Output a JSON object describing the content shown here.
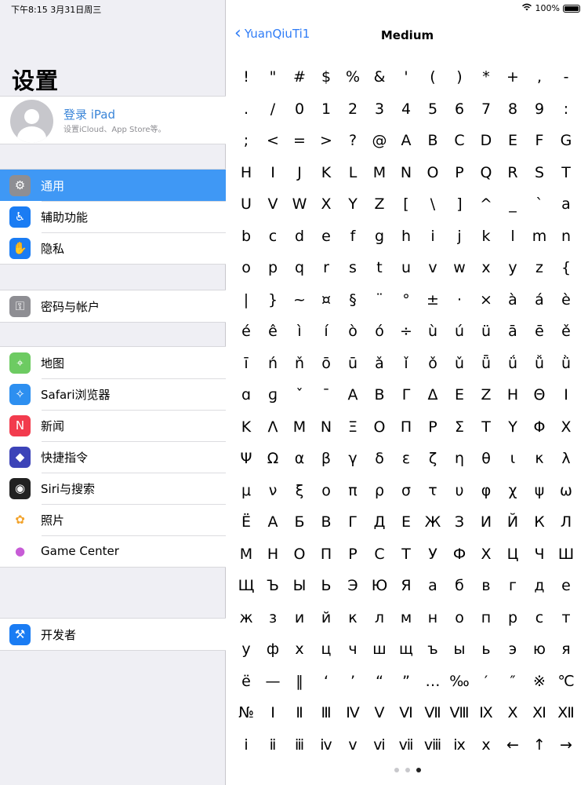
{
  "status": {
    "time": "下午8:15   3月31日周三",
    "wifi": "wifi-icon",
    "battery": "100%"
  },
  "sidebar": {
    "title": "设置",
    "profile": {
      "name": "登录 iPad",
      "subtitle": "设置iCloud、App Store等。"
    },
    "groups": [
      {
        "items": [
          {
            "label": "通用",
            "icon": "gear-icon",
            "color": "#8e8e93",
            "selected": true
          },
          {
            "label": "辅助功能",
            "icon": "accessibility-icon",
            "color": "#1a7cf3"
          },
          {
            "label": "隐私",
            "icon": "hand-icon",
            "color": "#1a7cf3"
          }
        ]
      },
      {
        "items": [
          {
            "label": "密码与帐户",
            "icon": "key-icon",
            "color": "#8e8e93"
          }
        ]
      },
      {
        "items": [
          {
            "label": "地图",
            "icon": "maps-icon",
            "color": "#6dcb62"
          },
          {
            "label": "Safari浏览器",
            "icon": "safari-icon",
            "color": "#2d8ff0"
          },
          {
            "label": "新闻",
            "icon": "news-icon",
            "color": "#f23b4d"
          },
          {
            "label": "快捷指令",
            "icon": "shortcuts-icon",
            "color": "#3c43b8"
          },
          {
            "label": "Siri与搜索",
            "icon": "siri-icon",
            "color": "#222222"
          },
          {
            "label": "照片",
            "icon": "photos-icon",
            "color": "#ffffff"
          },
          {
            "label": "Game Center",
            "icon": "game-center-icon",
            "color": "#ffffff"
          }
        ]
      },
      {
        "items": [
          {
            "label": "开发者",
            "icon": "hammer-icon",
            "color": "#1a7cf3"
          }
        ]
      }
    ]
  },
  "detail": {
    "back_label": "YuanQiuTi1",
    "title": "Medium",
    "glyph_rows": [
      [
        "!",
        "\"",
        "#",
        "$",
        "%",
        "&",
        "'",
        "(",
        ")",
        "*",
        "+",
        ",",
        "-"
      ],
      [
        ".",
        "/",
        "0",
        "1",
        "2",
        "3",
        "4",
        "5",
        "6",
        "7",
        "8",
        "9",
        ":"
      ],
      [
        ";",
        "<",
        "=",
        ">",
        "?",
        "@",
        "A",
        "B",
        "C",
        "D",
        "E",
        "F",
        "G"
      ],
      [
        "H",
        "I",
        "J",
        "K",
        "L",
        "M",
        "N",
        "O",
        "P",
        "Q",
        "R",
        "S",
        "T"
      ],
      [
        "U",
        "V",
        "W",
        "X",
        "Y",
        "Z",
        "[",
        "\\",
        "]",
        "^",
        "_",
        "`",
        "a"
      ],
      [
        "b",
        "c",
        "d",
        "e",
        "f",
        "g",
        "h",
        "i",
        "j",
        "k",
        "l",
        "m",
        "n"
      ],
      [
        "o",
        "p",
        "q",
        "r",
        "s",
        "t",
        "u",
        "v",
        "w",
        "x",
        "y",
        "z",
        "{"
      ],
      [
        "|",
        "}",
        "~",
        "¤",
        "§",
        "¨",
        "°",
        "±",
        "·",
        "×",
        "à",
        "á",
        "è"
      ],
      [
        "é",
        "ê",
        "ì",
        "í",
        "ò",
        "ó",
        "÷",
        "ù",
        "ú",
        "ü",
        "ā",
        "ē",
        "ě"
      ],
      [
        "ī",
        "ń",
        "ň",
        "ō",
        "ū",
        "ǎ",
        "ǐ",
        "ǒ",
        "ǔ",
        "ǖ",
        "ǘ",
        "ǚ",
        "ǜ"
      ],
      [
        "ɑ",
        "ɡ",
        "ˇ",
        "ˉ",
        "Α",
        "Β",
        "Γ",
        "Δ",
        "Ε",
        "Ζ",
        "Η",
        "Θ",
        "Ι"
      ],
      [
        "Κ",
        "Λ",
        "Μ",
        "Ν",
        "Ξ",
        "Ο",
        "Π",
        "Ρ",
        "Σ",
        "Τ",
        "Υ",
        "Φ",
        "Χ"
      ],
      [
        "Ψ",
        "Ω",
        "α",
        "β",
        "γ",
        "δ",
        "ε",
        "ζ",
        "η",
        "θ",
        "ι",
        "κ",
        "λ"
      ],
      [
        "μ",
        "ν",
        "ξ",
        "ο",
        "π",
        "ρ",
        "σ",
        "τ",
        "υ",
        "φ",
        "χ",
        "ψ",
        "ω"
      ],
      [
        "Ё",
        "А",
        "Б",
        "В",
        "Г",
        "Д",
        "Е",
        "Ж",
        "З",
        "И",
        "Й",
        "К",
        "Л"
      ],
      [
        "М",
        "Н",
        "О",
        "П",
        "Р",
        "С",
        "Т",
        "У",
        "Ф",
        "Х",
        "Ц",
        "Ч",
        "Ш"
      ],
      [
        "Щ",
        "Ъ",
        "Ы",
        "Ь",
        "Э",
        "Ю",
        "Я",
        "а",
        "б",
        "в",
        "г",
        "д",
        "е"
      ],
      [
        "ж",
        "з",
        "и",
        "й",
        "к",
        "л",
        "м",
        "н",
        "о",
        "п",
        "р",
        "с",
        "т"
      ],
      [
        "у",
        "ф",
        "х",
        "ц",
        "ч",
        "ш",
        "щ",
        "ъ",
        "ы",
        "ь",
        "э",
        "ю",
        "я"
      ],
      [
        "ё",
        "—",
        "‖",
        "‘",
        "’",
        "“",
        "”",
        "…",
        "‰",
        "′",
        "″",
        "※",
        "℃"
      ],
      [
        "№",
        "Ⅰ",
        "Ⅱ",
        "Ⅲ",
        "Ⅳ",
        "Ⅴ",
        "Ⅵ",
        "Ⅶ",
        "Ⅷ",
        "Ⅸ",
        "Ⅹ",
        "Ⅺ",
        "Ⅻ"
      ],
      [
        "ⅰ",
        "ⅱ",
        "ⅲ",
        "ⅳ",
        "ⅴ",
        "ⅵ",
        "ⅶ",
        "ⅷ",
        "ⅸ",
        "ⅹ",
        "←",
        "↑",
        "→"
      ]
    ],
    "page_count": 3,
    "current_page": 3
  }
}
